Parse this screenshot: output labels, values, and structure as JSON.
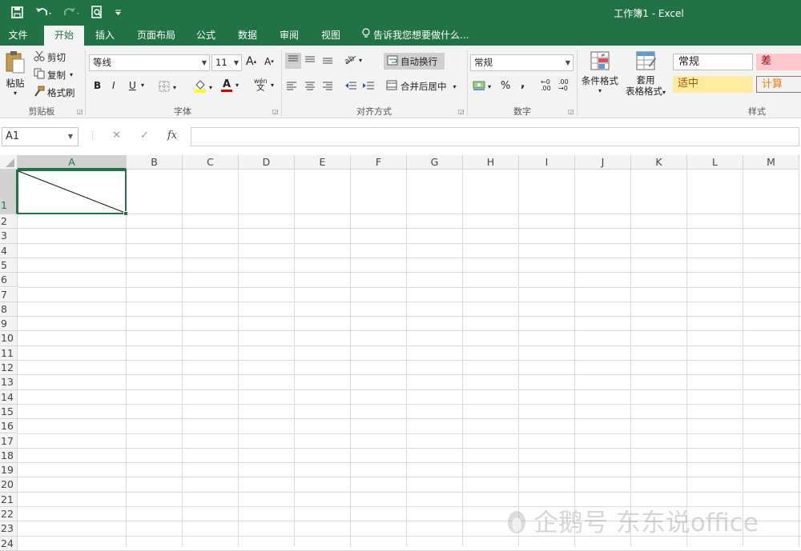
{
  "window": {
    "title": "工作簿1 - Excel"
  },
  "colors": {
    "accent": "#217346",
    "ribbon_bg": "#f3f3f3",
    "bad_fill": "#ffc7ce",
    "bad_text": "#9c0006",
    "neutral_fill": "#ffeb9c",
    "neutral_text": "#9c5700",
    "calc_fill": "#f2f2f2",
    "calc_text": "#fa7d00"
  },
  "qat": {
    "icons": [
      "save-icon",
      "undo-icon",
      "redo-icon",
      "print-preview-icon",
      "customize-icon"
    ]
  },
  "tabs": [
    "文件",
    "开始",
    "插入",
    "页面布局",
    "公式",
    "数据",
    "审阅",
    "视图"
  ],
  "active_tab": "开始",
  "tell_me": "告诉我您想要做什么...",
  "ribbon": {
    "clipboard": {
      "paste": "粘贴",
      "cut": "剪切",
      "copy": "复制",
      "format_painter": "格式刷",
      "label": "剪贴板"
    },
    "font": {
      "name": "等线",
      "size": "11",
      "grow": "A",
      "shrink": "A",
      "bold": "B",
      "italic": "I",
      "underline": "U",
      "font_color_letter": "A",
      "phonetic_top": "wén",
      "phonetic_bottom": "文",
      "label": "字体"
    },
    "alignment": {
      "wrap_text": "自动换行",
      "merge_center": "合并后居中",
      "label": "对齐方式"
    },
    "number": {
      "format": "常规",
      "percent": "%",
      "comma": ",",
      "inc_decimal": "←0 .00",
      "dec_decimal": ".00 →0",
      "label": "数字"
    },
    "styles": {
      "conditional": "条件格式",
      "table_line1": "套用",
      "table_line2": "表格格式",
      "normal": "常规",
      "bad": "差",
      "neutral": "适中",
      "calc": "计算",
      "label": "样式"
    }
  },
  "formula_bar": {
    "name_box": "A1",
    "cancel": "✕",
    "enter": "✓",
    "fx": "fx",
    "value": ""
  },
  "sheet": {
    "columns": [
      "A",
      "B",
      "C",
      "D",
      "E",
      "F",
      "G",
      "H",
      "I",
      "J",
      "K",
      "L",
      "M"
    ],
    "rows": [
      "1",
      "2",
      "3",
      "4",
      "5",
      "6",
      "7",
      "8",
      "9",
      "10",
      "11",
      "12",
      "13",
      "14",
      "15",
      "16",
      "17",
      "18",
      "19",
      "20",
      "21",
      "22",
      "23",
      "24"
    ],
    "active_cell": "A1"
  },
  "watermark": "企鹅号 东东说office"
}
